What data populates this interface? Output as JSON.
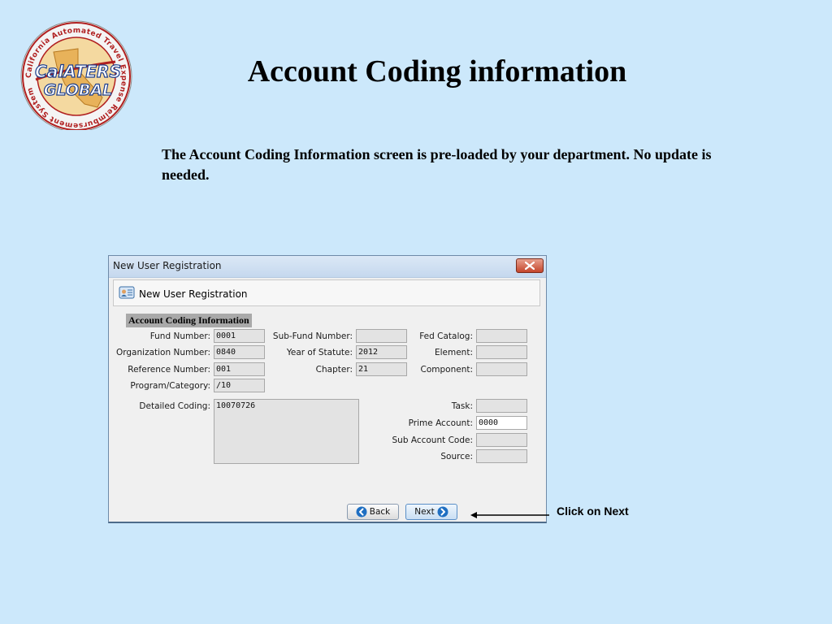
{
  "slide": {
    "title": "Account Coding information",
    "body": "The Account Coding Information screen is pre-loaded by your department. No update is needed.",
    "callout": "Click on Next"
  },
  "logo": {
    "ring_text": "California Automated Travel Expense Reimbursement System",
    "line1": "CalATERS",
    "line2": "GLOBAL"
  },
  "window": {
    "title": "New User Registration",
    "header": "New User Registration",
    "section": "Account Coding Information",
    "fields": {
      "fund_number": {
        "label": "Fund Number:",
        "value": "0001"
      },
      "organization_number": {
        "label": "Organization Number:",
        "value": "0840"
      },
      "reference_number": {
        "label": "Reference Number:",
        "value": "001"
      },
      "program_category": {
        "label": "Program/Category:",
        "value": "/10"
      },
      "detailed_coding": {
        "label": "Detailed Coding:",
        "value": "10070726"
      },
      "sub_fund_number": {
        "label": "Sub-Fund Number:",
        "value": ""
      },
      "year_of_statute": {
        "label": "Year of Statute:",
        "value": "2012"
      },
      "chapter": {
        "label": "Chapter:",
        "value": "21"
      },
      "fed_catalog": {
        "label": "Fed Catalog:",
        "value": ""
      },
      "element": {
        "label": "Element:",
        "value": ""
      },
      "component": {
        "label": "Component:",
        "value": ""
      },
      "task": {
        "label": "Task:",
        "value": ""
      },
      "prime_account": {
        "label": "Prime Account:",
        "value": "0000"
      },
      "sub_account_code": {
        "label": "Sub Account Code:",
        "value": ""
      },
      "source": {
        "label": "Source:",
        "value": ""
      }
    },
    "buttons": {
      "back": "Back",
      "next": "Next"
    }
  },
  "colors": {
    "background": "#cce8fb",
    "close_button": "#c4452a",
    "nav_icon": "#1f6fc2"
  }
}
